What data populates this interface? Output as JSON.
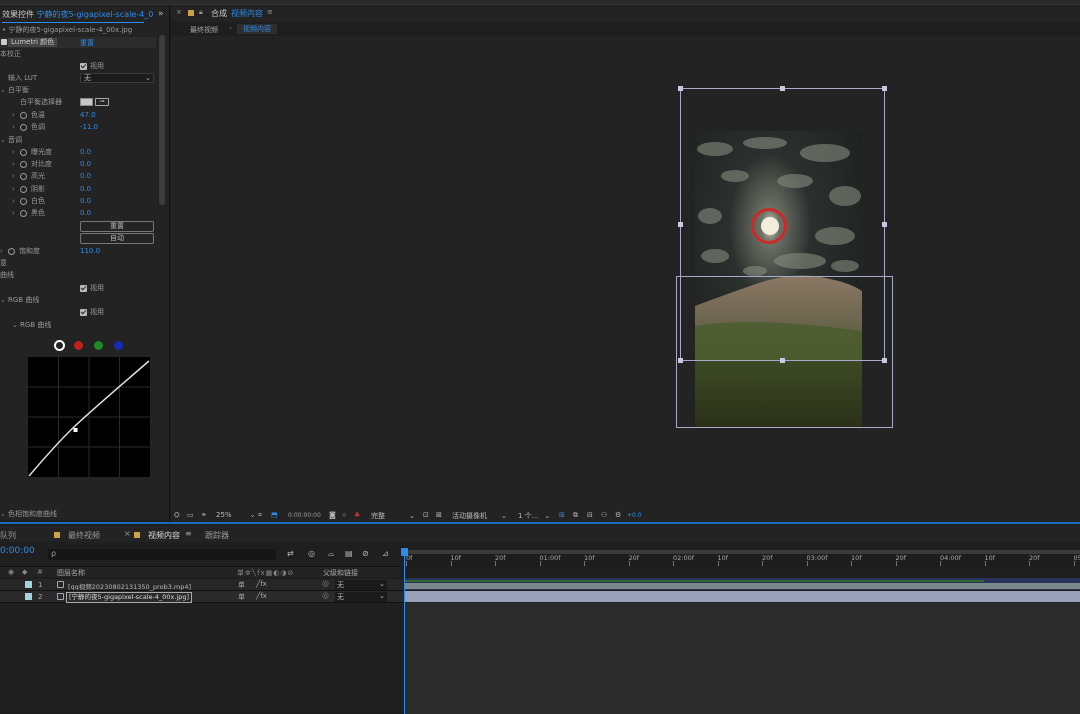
{
  "effects_panel": {
    "tab_title": "效果控件",
    "tab_file": "宁静的夜5-gigapixel-scale-4_0",
    "layer_path": "• 宁静的夜5-gigapixel-scale-4_00x.jpg",
    "effect_name": "Lumetri 颜色",
    "reset_label": "重置",
    "basic_correction": "本校正",
    "show_label": "视用",
    "input_lut_label": "输入 LUT",
    "input_lut_value": "无",
    "white_balance": "白平衡",
    "wb_selector": "白平衡选择器",
    "temperature_label": "色温",
    "temperature_value": "47.0",
    "tint_label": "色调",
    "tint_value": "-11.0",
    "tone": "音调",
    "exposure_label": "曝光度",
    "exposure_value": "0.0",
    "contrast_label": "对比度",
    "contrast_value": "0.0",
    "highlights_label": "高光",
    "highlights_value": "0.0",
    "shadows_label": "阴影",
    "shadows_value": "0.0",
    "whites_label": "白色",
    "whites_value": "0.0",
    "blacks_label": "黑色",
    "blacks_value": "0.0",
    "reset_button": "重置",
    "auto_button": "自动",
    "saturation_label": "饱和度",
    "saturation_value": "110.0",
    "creative": "意",
    "curves": "曲线",
    "show_label2": "视用",
    "rgb_curves": "RGB 曲线",
    "show_label3": "视用",
    "rgb_curves_sub": "RGB 曲线",
    "hue_sat_curves": "色相饱和度曲线",
    "channel_colors": [
      "#ffffff",
      "#c0201e",
      "#1c8a2a",
      "#1a2ab8"
    ]
  },
  "viewer": {
    "tab_icon_label": "合成",
    "tab_name": "视频内容",
    "breadcrumb_1": "最终视频",
    "breadcrumb_2": "视频内容",
    "zoom": "25%",
    "timecode": "0:00:00:00",
    "quality": "完整",
    "camera": "活动摄像机",
    "views": "1 个...",
    "exposure": "+0.0"
  },
  "timeline": {
    "tab_render_queue": "队列",
    "tab_final": "最终视频",
    "tab_content": "视频内容",
    "tab_tracker": "跟踪器",
    "timecode": "0:00:00",
    "search_placeholder": "",
    "col_source": "图层名称",
    "col_parent": "父级和链接",
    "ruler": [
      "0f",
      "10f",
      "20f",
      "01:00f",
      "10f",
      "20f",
      "02:00f",
      "10f",
      "20f",
      "03:00f",
      "10f",
      "20f",
      "04:00f",
      "10f",
      "20f",
      "05:0"
    ],
    "layers": [
      {
        "num": "1",
        "name": "[qq视频20230802131350_prob3.mp4]",
        "parent": "无"
      },
      {
        "num": "2",
        "name": "[宁静的夜5-gigapixel-scale-4_00x.jpg]",
        "parent": "无"
      }
    ]
  }
}
